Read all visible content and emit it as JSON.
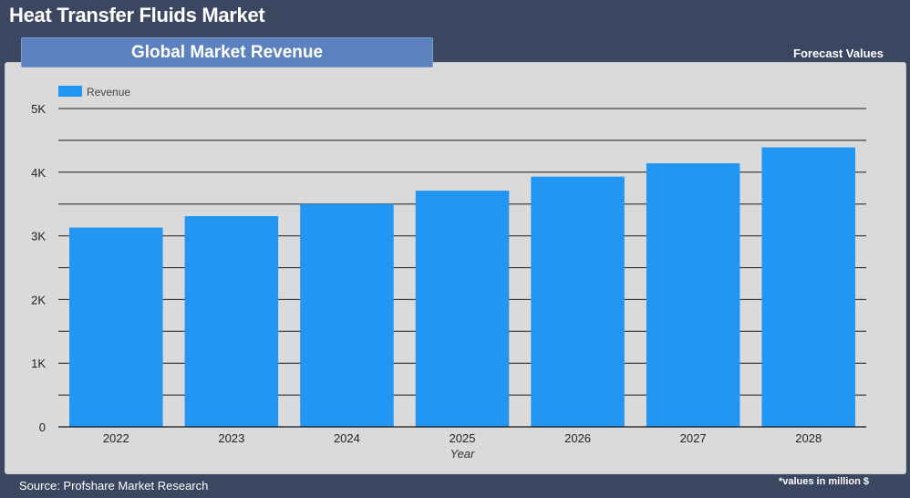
{
  "header": {
    "title": "Heat Transfer Fluids Market",
    "subtitle": "Global Market Revenue",
    "forecast_label": "Forecast Values"
  },
  "footer": {
    "source": "Source: Profshare Market Research",
    "units_note": "*values in million $"
  },
  "colors": {
    "bar": "#2196f3",
    "background": "#3b4760",
    "panel": "#dadada",
    "banner": "#5b82be"
  },
  "chart_data": {
    "type": "bar",
    "categories": [
      "2022",
      "2023",
      "2024",
      "2025",
      "2026",
      "2027",
      "2028"
    ],
    "series": [
      {
        "name": "Revenue",
        "values": [
          3130,
          3310,
          3500,
          3710,
          3930,
          4140,
          4390
        ]
      }
    ],
    "xlabel": "Year",
    "ylabel": "",
    "ylim": [
      0,
      5000
    ],
    "yticks": [
      0,
      1000,
      2000,
      3000,
      4000,
      5000
    ],
    "ytick_labels": [
      "0",
      "1K",
      "2K",
      "3K",
      "4K",
      "5K"
    ],
    "minor_gridlines": true,
    "grid": true,
    "legend_position": "top-left"
  }
}
